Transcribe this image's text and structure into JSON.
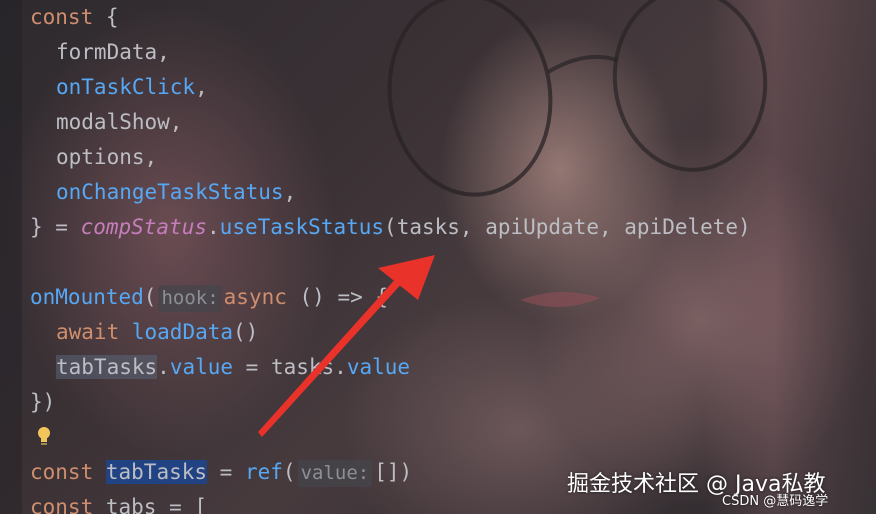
{
  "code": {
    "l1": {
      "kw": "const",
      "brace": " {"
    },
    "l2": {
      "text": "formData,"
    },
    "l3": {
      "fn": "onTaskClick",
      "punct": ","
    },
    "l4": {
      "text": "modalShow,"
    },
    "l5": {
      "text": "options,"
    },
    "l6": {
      "fn": "onChangeTaskStatus",
      "punct": ","
    },
    "l7": {
      "close": "} = ",
      "obj": "compStatus",
      "dot": ".",
      "fn": "useTaskStatus",
      "args": "(tasks, apiUpdate, apiDelete)"
    },
    "l9": {
      "fn": "onMounted",
      "paren": "(",
      "hint": "hook:",
      "kw": "async",
      "rest": " () => {"
    },
    "l10": {
      "kw": "await",
      "fn": "loadData",
      "rest": "()"
    },
    "l11": {
      "var": "tabTasks",
      "dot": ".",
      "prop": "value",
      "mid": " = tasks.",
      "prop2": "value"
    },
    "l12": {
      "text": "})"
    },
    "l14": {
      "kw": "const",
      "var": "tabTasks",
      "eq": " = ",
      "fn": "ref",
      "paren": "(",
      "hint": "value:",
      "rest": "[])"
    },
    "l15": {
      "kw": "const",
      "rest": " tabs = ["
    }
  },
  "watermark": {
    "main": "掘金技术社区 @ Java私教",
    "csdn": "CSDN @慧码逸学"
  },
  "icons": {
    "bulb": "lightbulb-icon",
    "arrow": "red-arrow-annotation"
  },
  "colors": {
    "keyword": "#cf8e6d",
    "function": "#56a8f5",
    "text": "#bcbec4",
    "italic": "#c77dbb",
    "arrow": "#e8322a"
  }
}
